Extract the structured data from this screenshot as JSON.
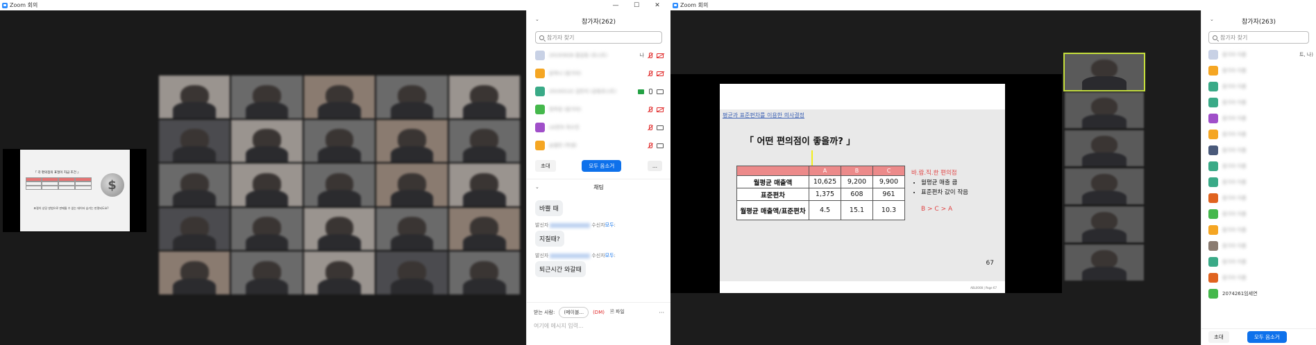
{
  "left_window": {
    "title": "Zoom 회의",
    "participants_header": "참가자(262)",
    "search_placeholder": "참가자 찾기",
    "participants": [
      {
        "name": "20193928 홍길동 (호스트)",
        "tag": "나",
        "avatar": "#c8d1e5",
        "mic": "off",
        "cam": "off",
        "share": false
      },
      {
        "name": "윤하나 (참가자)",
        "tag": "",
        "avatar": "#f5a623",
        "mic": "off",
        "cam": "off",
        "share": false
      },
      {
        "name": "20193122 김민지 (공동호스트)",
        "tag": "",
        "avatar": "#3aaa87",
        "mic": "on",
        "cam": "on",
        "share": true
      },
      {
        "name": "정주원 (참가자)",
        "tag": "",
        "avatar": "#45b84c",
        "mic": "off",
        "cam": "off",
        "share": false
      },
      {
        "name": "LG전자 최수진",
        "tag": "",
        "avatar": "#a04fc9",
        "mic": "off",
        "cam": "on",
        "share": false
      },
      {
        "name": "송철민 (학생)",
        "tag": "",
        "avatar": "#f5a623",
        "mic": "off",
        "cam": "on",
        "share": false
      }
    ],
    "invite_label": "초대",
    "mute_all_label": "모두 음소거",
    "more_label": "...",
    "chat_header": "채팅",
    "messages": [
      {
        "text": "바쁠 때",
        "meta_prefix": "발신자",
        "meta_mid": "수신자",
        "meta_to": "모두"
      },
      {
        "text": "지칠때?",
        "meta_prefix": "발신자",
        "meta_mid": "수신자",
        "meta_to": "모두"
      },
      {
        "text": "퇴근시간 와갈때",
        "meta_prefix": "",
        "meta_mid": "",
        "meta_to": ""
      }
    ],
    "to_label": "받는 사람:",
    "to_value": "(메이블...",
    "dm_label": "(DM)",
    "file_label": "파일",
    "more_dots": "···",
    "message_placeholder": "여기에 메시지 입력..."
  },
  "left_share_slide": {
    "title": "『 각 편의점의 표절이 지급 조건 』",
    "note": "표절이 상당 방법으로 판매될 수 없는 데이터 습기는 판명되도요?",
    "coin_symbol": "$"
  },
  "right_window": {
    "title": "Zoom 회의",
    "participants_header": "참가자(263)",
    "search_placeholder": "참가자 찾기",
    "first_row_tag": "트, 나)",
    "last_row_name": "2074261임세연",
    "invite_label": "초대",
    "mute_all_label": "모두 음소거",
    "participant_avatars": [
      "#c8d1e5",
      "#f5a623",
      "#3aaa87",
      "#3aaa87",
      "#a04fc9",
      "#f5a623",
      "#4a5a7a",
      "#3aaa87",
      "#3aaa87",
      "#e0631f",
      "#45b84c",
      "#f5a623",
      "#8a7b70",
      "#3aaa87",
      "#e0631f",
      "#45b84c"
    ]
  },
  "slide": {
    "subtitle": "평균과 표준편차를 이용한 의사결정",
    "title": "「 어떤 편의점이 좋을까? 」",
    "table": {
      "headers": [
        "",
        "A",
        "B",
        "C"
      ],
      "rows": [
        [
          "월평균 매출액",
          "10,625",
          "9,200",
          "9,900"
        ],
        [
          "표준편차",
          "1,375",
          "608",
          "961"
        ],
        [
          "월평균 매출액/표준편차",
          "4.5",
          "15.1",
          "10.3"
        ]
      ]
    },
    "note_title": "바.람.직.한 편의점",
    "note_items": [
      "월평균 매출 큼",
      "표준편차 값이 작음"
    ],
    "ranking": "B > C > A",
    "page_number": "67",
    "footer": "ABL0008 | Page 67"
  }
}
